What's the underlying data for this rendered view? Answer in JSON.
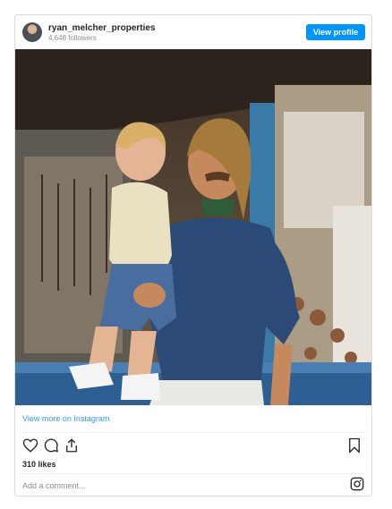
{
  "header": {
    "username": "ryan_melcher_properties",
    "followers": "4,648 followers",
    "view_profile_label": "View profile"
  },
  "post": {
    "view_more_label": "View more on Instagram",
    "likes": "310 likes",
    "comment_placeholder": "Add a comment..."
  },
  "icons": {
    "like": "heart-icon",
    "comment": "comment-icon",
    "share": "share-icon",
    "save": "bookmark-icon",
    "brand": "instagram-icon"
  },
  "colors": {
    "accent": "#0095f6",
    "link": "#3897f0",
    "text": "#262626",
    "muted": "#8e8e8e",
    "border": "#dbdbdb"
  }
}
